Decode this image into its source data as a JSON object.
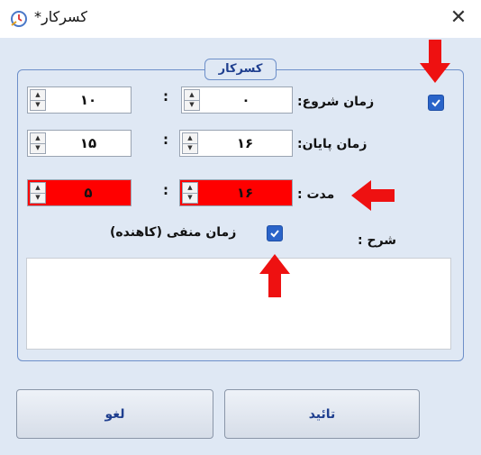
{
  "window": {
    "title": "کسرکار*",
    "icon": "clock-app-icon",
    "close_glyph": "✕"
  },
  "group": {
    "caption": "کسرکار"
  },
  "start_time": {
    "label": "زمان شروع:",
    "enabled": true,
    "hour": "۰",
    "minute": "۱۰",
    "separator": ":"
  },
  "end_time": {
    "label": "زمان پایان:",
    "hour": "۱۶",
    "minute": "۱۵",
    "separator": ":"
  },
  "duration": {
    "label": "مدت :",
    "hour": "۱۶",
    "minute": "۵",
    "separator": ":",
    "highlight_color": "#ff0000"
  },
  "negative_time": {
    "label": "زمان منفی (کاهنده)",
    "checked": true
  },
  "description": {
    "label": "شرح :",
    "value": ""
  },
  "buttons": {
    "confirm": "تائید",
    "cancel": "لغو"
  },
  "annotations": {
    "arrow_color": "#ee1111"
  }
}
